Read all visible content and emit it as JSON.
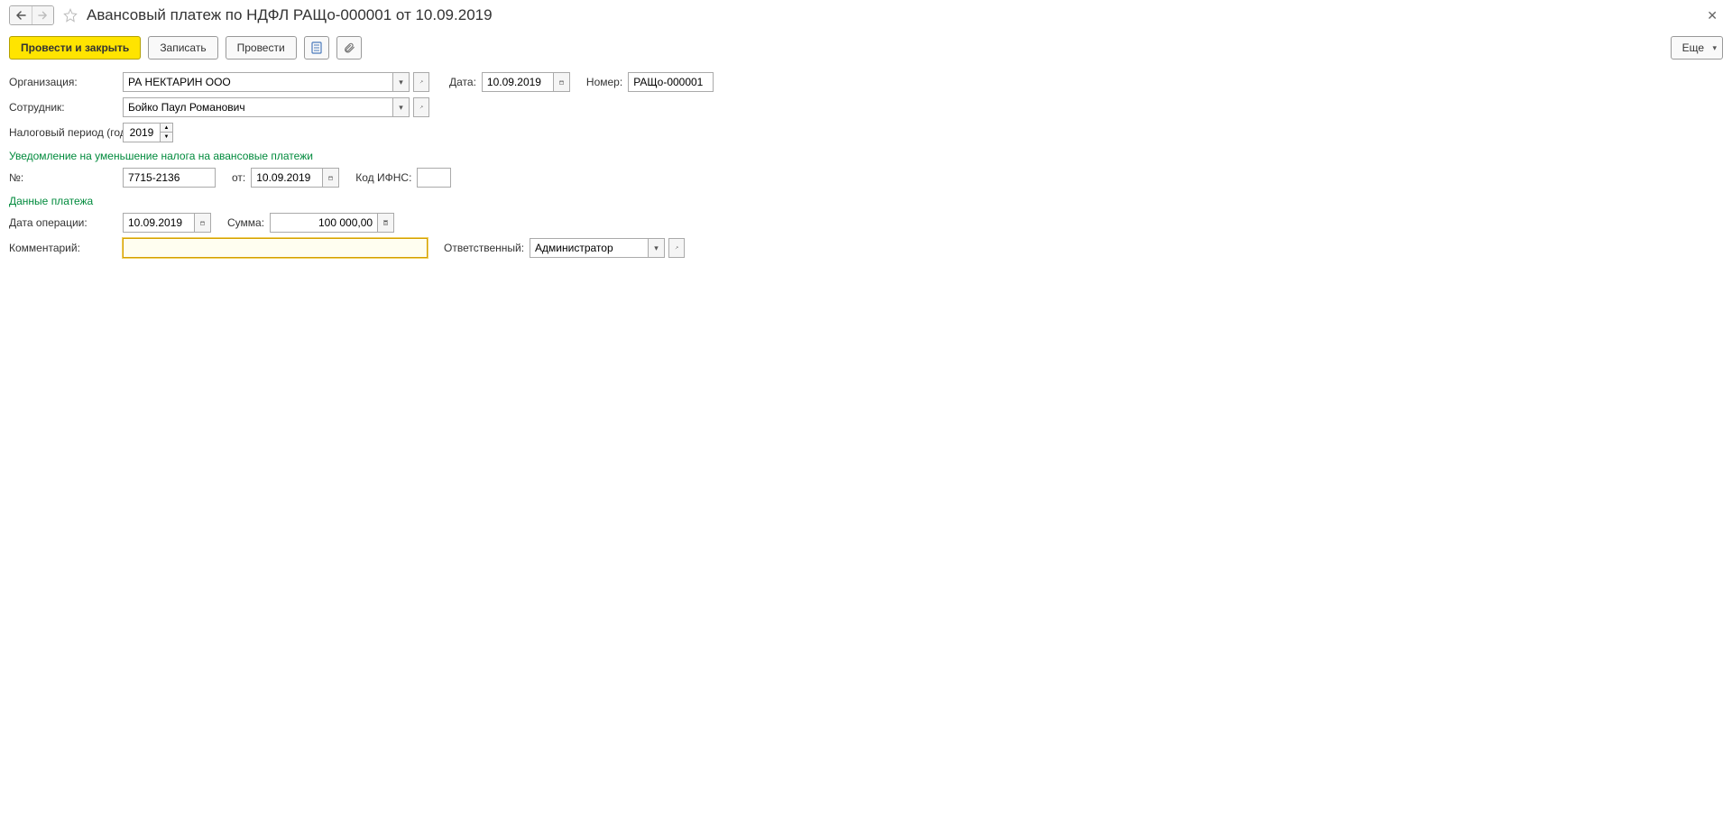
{
  "header": {
    "title": "Авансовый платеж по НДФЛ РАЩо-000001 от 10.09.2019"
  },
  "toolbar": {
    "post_close": "Провести и закрыть",
    "save": "Записать",
    "post": "Провести",
    "more": "Еще"
  },
  "fields": {
    "organization_label": "Организация:",
    "organization_value": "РА НЕКТАРИН ООО",
    "date_label": "Дата:",
    "date_value": "10.09.2019",
    "number_label": "Номер:",
    "number_value": "РАЩо-000001",
    "employee_label": "Сотрудник:",
    "employee_value": "Бойко Паул Романович",
    "tax_period_label": "Налоговый период (год):",
    "tax_period_value": "2019"
  },
  "notification": {
    "section_title": "Уведомление на уменьшение налога на авансовые платежи",
    "no_label": "№:",
    "no_value": "7715-2136",
    "from_label": "от:",
    "from_value": "10.09.2019",
    "ifns_label": "Код ИФНС:",
    "ifns_value": ""
  },
  "payment": {
    "section_title": "Данные платежа",
    "op_date_label": "Дата операции:",
    "op_date_value": "10.09.2019",
    "sum_label": "Сумма:",
    "sum_value": "100 000,00",
    "comment_label": "Комментарий:",
    "comment_value": "",
    "responsible_label": "Ответственный:",
    "responsible_value": "Администратор"
  }
}
